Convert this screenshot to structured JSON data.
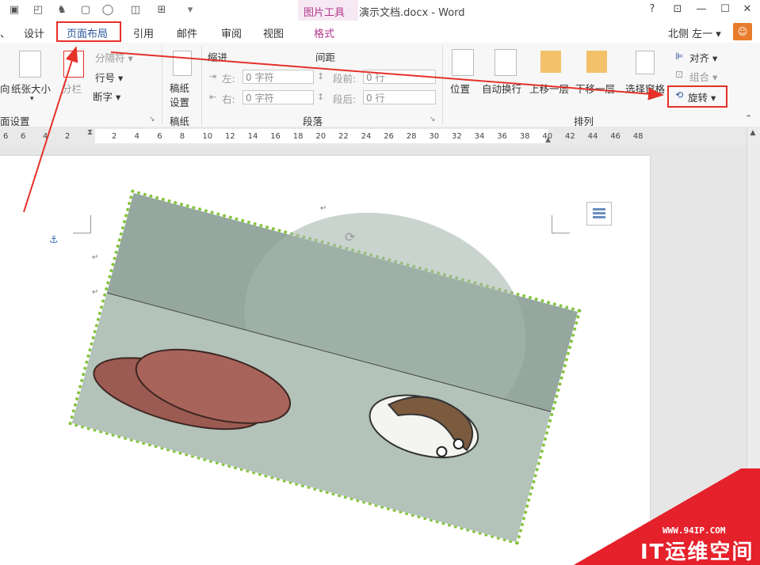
{
  "title_bar": {
    "context_tab_title": "图片工具",
    "document_title": "演示文档.docx - Word",
    "help": "?",
    "minimize": "—",
    "restore": "☐",
    "close": "✕"
  },
  "tabs": {
    "items": [
      "、",
      "设计",
      "页面布局",
      "引用",
      "邮件",
      "审阅",
      "视图",
      "格式"
    ],
    "active": "页面布局",
    "user_name": "北侧 左一 ▾"
  },
  "ribbon": {
    "page_setup": {
      "group_label": "面设置",
      "orientation_label": "向",
      "paper_size_label": "纸张大小",
      "columns_label": "分栏",
      "breaks_label": "分隔符 ▾",
      "line_numbers_label": "行号 ▾",
      "hyphenation_label": "断字 ▾"
    },
    "manuscript": {
      "group_label": "稿纸",
      "button_line1": "稿纸",
      "button_line2": "设置"
    },
    "paragraph": {
      "group_label": "段落",
      "indent_header": "缩进",
      "spacing_header": "间距",
      "indent_left_label": "左:",
      "indent_left_value": "0 字符",
      "indent_right_label": "右:",
      "indent_right_value": "0 字符",
      "spacing_before_label": "段前:",
      "spacing_before_value": "0 行",
      "spacing_after_label": "段后:",
      "spacing_after_value": "0 行"
    },
    "arrange": {
      "group_label": "排列",
      "position_label": "位置",
      "wrap_text_label": "自动换行",
      "bring_forward_label": "上移一层",
      "send_backward_label": "下移一层",
      "selection_pane_label": "选择窗格",
      "align_label": "对齐 ▾",
      "group_label_btn": "组合 ▾",
      "rotate_label": "旋转 ▾"
    }
  },
  "ruler": {
    "left_ticks": [
      "6",
      "6",
      "4",
      "2"
    ],
    "ticks": [
      "2",
      "4",
      "6",
      "8",
      "10",
      "12",
      "14",
      "16",
      "18",
      "20",
      "22",
      "24",
      "26",
      "28",
      "30",
      "32",
      "34",
      "36",
      "38",
      "40",
      "42",
      "44",
      "46",
      "48"
    ]
  },
  "document": {
    "paragraph_mark": "↵",
    "anchor_symbol": "⚓"
  },
  "watermark": {
    "url": "WWW.94IP.COM",
    "name": "IT运维空间"
  },
  "colors": {
    "accent_red": "#e5312a",
    "context_purple": "#b0378b",
    "selection_green": "#86c440"
  }
}
